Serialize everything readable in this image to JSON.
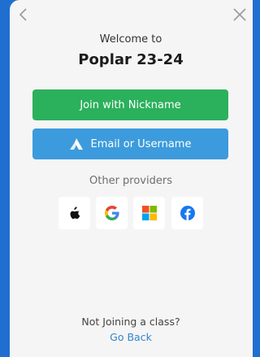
{
  "header": {
    "welcome": "Welcome to",
    "class_name": "Poplar 23-24"
  },
  "nav": {
    "back_icon": "chevron-left-icon",
    "close_icon": "close-icon"
  },
  "buttons": {
    "nickname_label": "Join with Nickname",
    "email_label": "Email or Username",
    "nickname_color": "#2bb05c",
    "email_color": "#3c9bdc"
  },
  "providers": {
    "label": "Other providers",
    "items": [
      {
        "name": "apple",
        "icon": "apple-icon"
      },
      {
        "name": "google",
        "icon": "google-icon"
      },
      {
        "name": "microsoft",
        "icon": "microsoft-icon"
      },
      {
        "name": "facebook",
        "icon": "facebook-icon"
      }
    ]
  },
  "footer": {
    "question": "Not Joining a class?",
    "link": "Go Back"
  },
  "colors": {
    "backdrop": "#1f6fd1",
    "card": "#f5f5f5",
    "link": "#2f86cf"
  }
}
